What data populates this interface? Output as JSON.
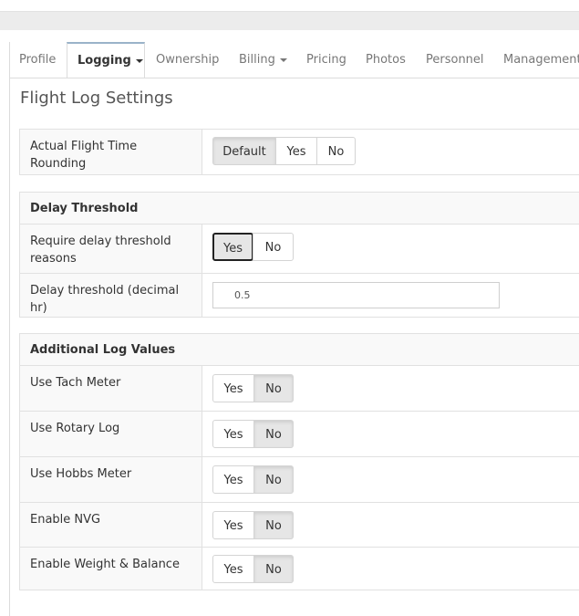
{
  "tabs": [
    {
      "label": "Profile",
      "dropdown": false,
      "active": false
    },
    {
      "label": "Logging",
      "dropdown": true,
      "active": true
    },
    {
      "label": "Ownership",
      "dropdown": false,
      "active": false
    },
    {
      "label": "Billing",
      "dropdown": true,
      "active": false
    },
    {
      "label": "Pricing",
      "dropdown": false,
      "active": false
    },
    {
      "label": "Photos",
      "dropdown": false,
      "active": false
    },
    {
      "label": "Personnel",
      "dropdown": false,
      "active": false
    },
    {
      "label": "Management",
      "dropdown": false,
      "active": false
    }
  ],
  "page_title": "Flight Log Settings",
  "rounding": {
    "label": "Actual Flight Time Rounding",
    "options": [
      "Default",
      "Yes",
      "No"
    ],
    "selected": "Default"
  },
  "delay": {
    "heading": "Delay Threshold",
    "require_label": "Require delay threshold reasons",
    "require_options": [
      "Yes",
      "No"
    ],
    "require_selected": "Yes",
    "threshold_label": "Delay threshold (decimal hr)",
    "threshold_value": "0.5"
  },
  "additional": {
    "heading": "Additional Log Values",
    "rows": [
      {
        "label": "Use Tach Meter",
        "yes": "Yes",
        "no": "No",
        "selected": "No"
      },
      {
        "label": "Use Rotary Log",
        "yes": "Yes",
        "no": "No",
        "selected": "No"
      },
      {
        "label": "Use Hobbs Meter",
        "yes": "Yes",
        "no": "No",
        "selected": "No"
      },
      {
        "label": "Enable NVG",
        "yes": "Yes",
        "no": "No",
        "selected": "No"
      },
      {
        "label": "Enable Weight & Balance",
        "yes": "Yes",
        "no": "No",
        "selected": "No"
      }
    ]
  },
  "colors": {
    "active_tab_border": "#9ab3c9",
    "panel_bg": "#f9f9f9",
    "button_active_bg": "#e6e6e6"
  }
}
